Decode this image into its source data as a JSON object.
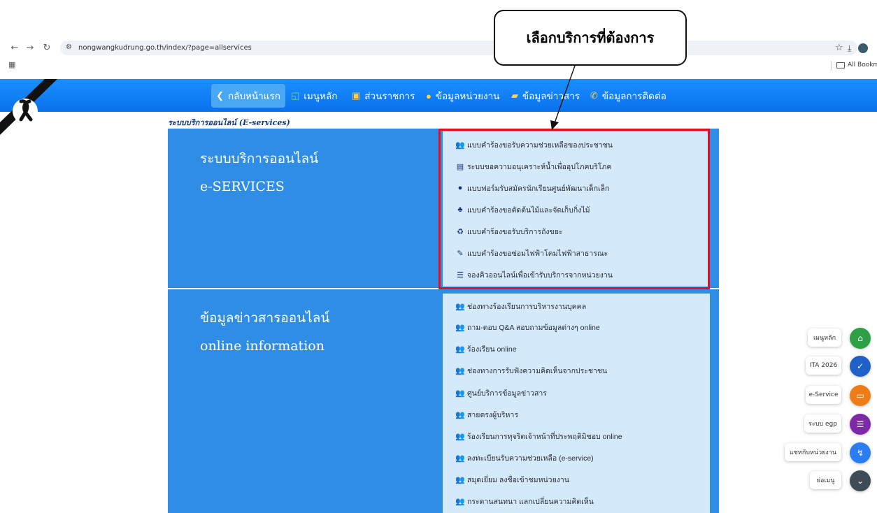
{
  "browser": {
    "url": "nongwangkudrung.go.th/index/?page=allservices",
    "bookmarks_label": "All Bookmarks"
  },
  "site_menu": [
    {
      "label": "กลับหน้าแรก",
      "icon": "chevron-left-icon"
    },
    {
      "label": "เมนูหลัก",
      "icon": "cast-icon"
    },
    {
      "label": "ส่วนราชการ",
      "icon": "calendar-icon"
    },
    {
      "label": "ข้อมูลหน่วยงาน",
      "icon": "info-icon"
    },
    {
      "label": "ข้อมูลข่าวสาร",
      "icon": "comments-icon"
    },
    {
      "label": "ข้อมูลการติดต่อ",
      "icon": "phone-icon"
    }
  ],
  "section_label": "ระบบบริการออนไลน์ (E-services)",
  "panel_eservices": {
    "title_th": "ระบบบริการออนไลน์",
    "title_en": "e-SERVICES",
    "items": [
      {
        "label": "แบบคำร้องขอรับความช่วยเหลือของประชาชน",
        "icon": "users-icon"
      },
      {
        "label": "ระบบขอความอนุเคราะห์น้ำเพื่ออุปโภคบริโภค",
        "icon": "id-card-icon"
      },
      {
        "label": "แบบฟอร์มรับสมัครนักเรียนศูนย์พัฒนาเด็กเล็ก",
        "icon": "comment-icon"
      },
      {
        "label": "แบบคำร้องขอตัดต้นไม้และจัดเก็บกิ่งไม้",
        "icon": "tree-icon"
      },
      {
        "label": "แบบคำร้องขอรับบริการถังขยะ",
        "icon": "recycle-icon"
      },
      {
        "label": "แบบคำร้องขอซ่อมไฟฟ้าโคมไฟฟ้าสาธารณะ",
        "icon": "wrench-icon"
      },
      {
        "label": "จองคิวออนไลน์เพื่อเข้ารับบริการจากหน่วยงาน",
        "icon": "list-icon"
      }
    ]
  },
  "panel_info": {
    "title_th": "ข้อมูลข่าวสารออนไลน์",
    "title_en": "online information",
    "items": [
      {
        "label": "ช่องทางร้องเรียนการบริหารงานบุคคล",
        "icon": "users-icon"
      },
      {
        "label": "ถาม-ตอบ Q&A สอบถามข้อมูลต่างๆ online",
        "icon": "users-icon"
      },
      {
        "label": "ร้องเรียน online",
        "icon": "users-icon"
      },
      {
        "label": "ช่องทางการรับฟังความคิดเห็นจากประชาชน",
        "icon": "users-icon"
      },
      {
        "label": "ศูนย์บริการข้อมูลข่าวสาร",
        "icon": "users-icon"
      },
      {
        "label": "สายตรงผู้บริหาร",
        "icon": "users-icon"
      },
      {
        "label": "ร้องเรียนการทุจริตเจ้าหน้าที่ประพฤติมิชอบ online",
        "icon": "users-icon"
      },
      {
        "label": "ลงทะเบียนรับความช่วยเหลือ (e-service)",
        "icon": "users-icon"
      },
      {
        "label": "สมุดเยี่ยม ลงชื่อเข้าชมหน่วยงาน",
        "icon": "users-icon"
      },
      {
        "label": "กระดานสนทนา แลกเปลี่ยนความคิดเห็น",
        "icon": "users-icon"
      }
    ]
  },
  "callout_text": "เลือกบริการที่ต้องการ",
  "side_menu": [
    {
      "label": "เมนูหลัก",
      "icon": "home-icon",
      "color": "#2e9f45"
    },
    {
      "label": "ITA 2026",
      "icon": "check-badge-icon",
      "color": "#1f61c9"
    },
    {
      "label": "e-Service",
      "icon": "monitor-icon",
      "color": "#f07c17"
    },
    {
      "label": "ระบบ egp",
      "icon": "list-icon",
      "color": "#7d2aa8"
    },
    {
      "label": "แชทกับหน่วยงาน",
      "icon": "messenger-icon",
      "color": "#2c7df3"
    },
    {
      "label": "ย่อเมนู",
      "icon": "chevron-down-icon",
      "color": "#3f4b57"
    }
  ],
  "colors": {
    "header_blue": "#0a71ec",
    "panel_blue": "#2f8de6",
    "list_bg": "#d4eafb",
    "highlight_red": "#e3111e",
    "icon_green": "#1c8a3a",
    "icon_navy": "#1b2d7a"
  }
}
